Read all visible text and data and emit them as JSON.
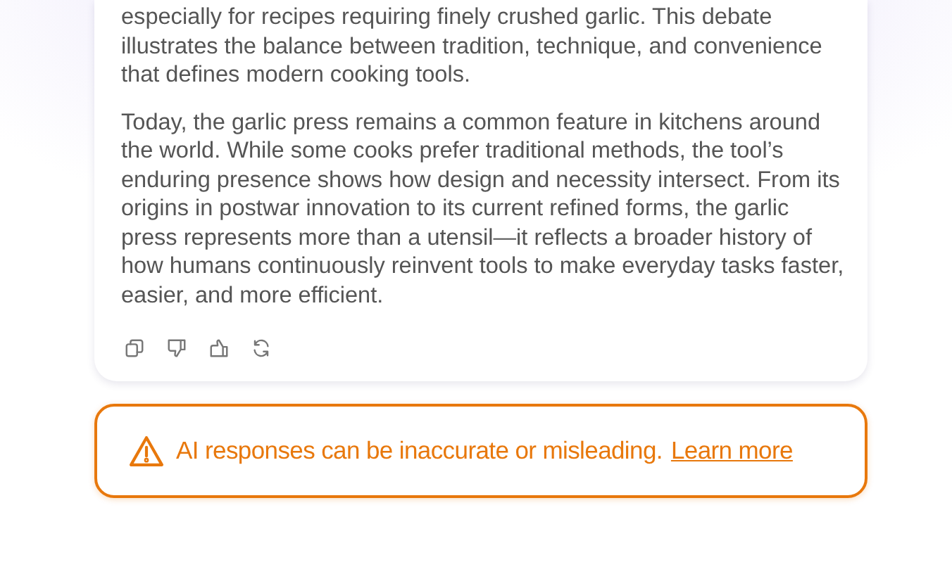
{
  "response": {
    "paragraphs": [
      "especially for recipes requiring finely crushed garlic. This debate illustrates the balance between tradition, technique, and convenience that defines modern cooking tools.",
      "Today, the garlic press remains a common feature in kitchens around the world. While some cooks prefer traditional methods, the tool’s enduring presence shows how design and necessity intersect. From its origins in postwar innovation to its current refined forms, the garlic press represents more than a utensil—it reflects a broader history of how humans continuously reinvent tools to make everyday tasks faster, easier, and more efficient."
    ],
    "actions": [
      {
        "kind": "copy"
      },
      {
        "kind": "dislike"
      },
      {
        "kind": "like"
      },
      {
        "kind": "regenerate"
      }
    ]
  },
  "warning": {
    "message": "AI responses can be inaccurate or misleading.",
    "link": "Learn more"
  }
}
